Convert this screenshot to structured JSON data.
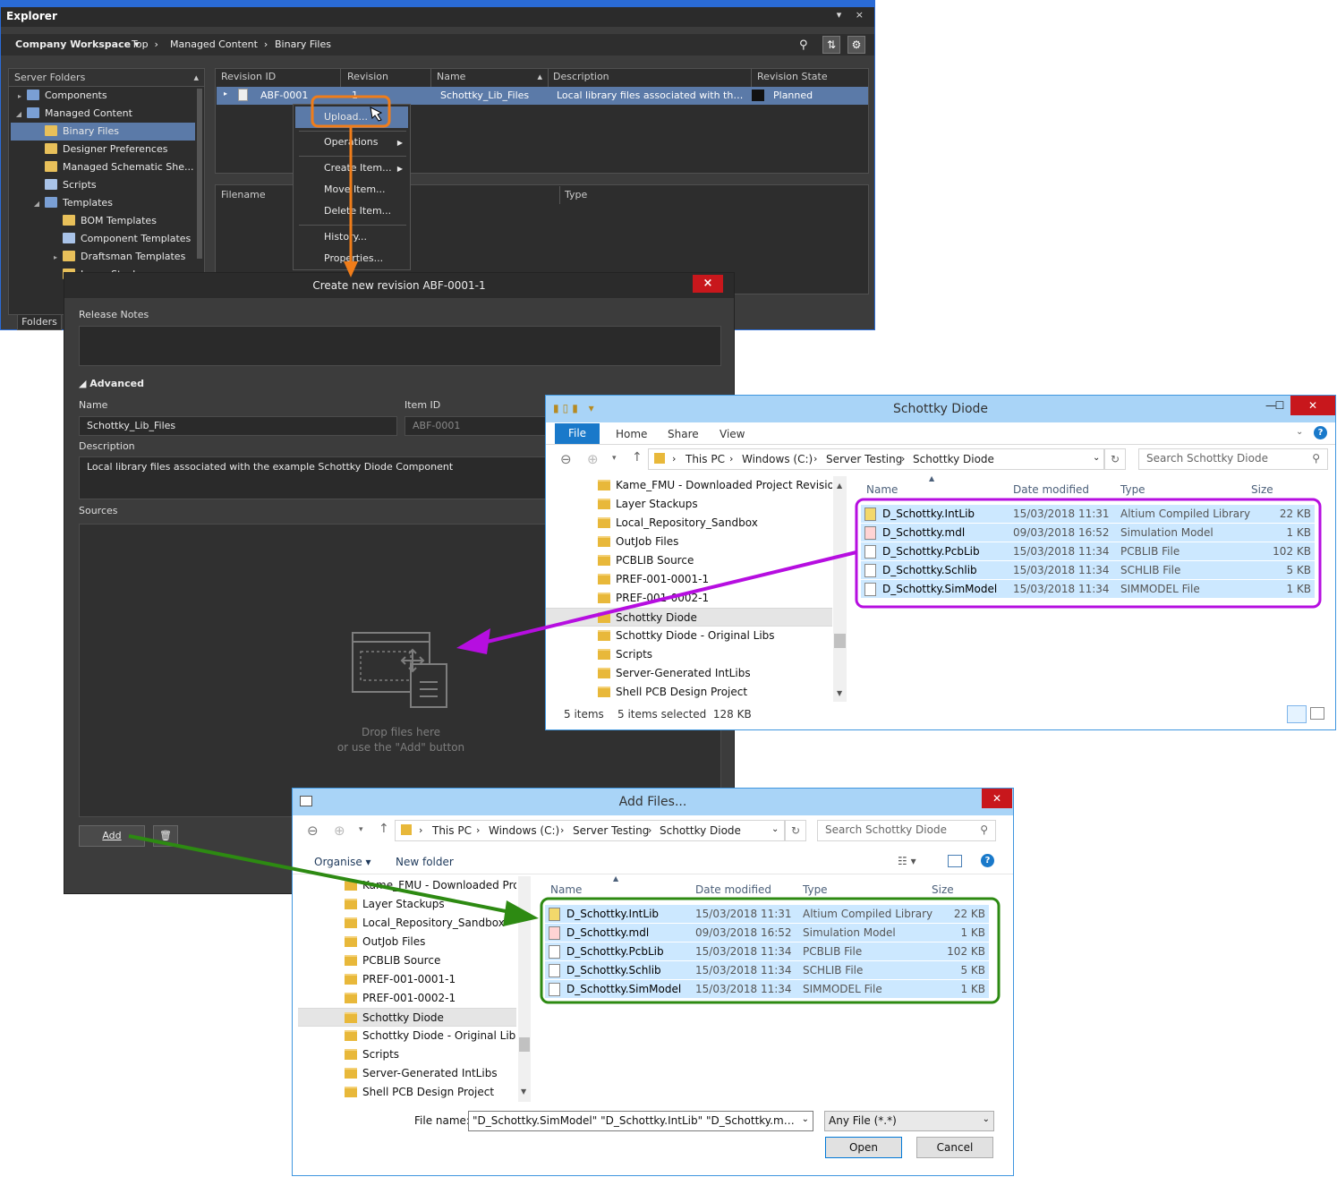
{
  "explorer": {
    "title": "Explorer",
    "controls": "▾ ×",
    "workspace": "Company Workspace",
    "breadcrumbs": [
      "Top",
      "Managed Content",
      "Binary Files"
    ],
    "folders_header": "Server Folders",
    "folders": [
      {
        "label": "Components",
        "indent": 0,
        "arrow": "▸",
        "color": "#7a9fd4"
      },
      {
        "label": "Managed Content",
        "indent": 0,
        "arrow": "◢",
        "color": "#7a9fd4"
      },
      {
        "label": "Binary Files",
        "indent": 1,
        "arrow": "",
        "color": "#e8c05a",
        "selected": true
      },
      {
        "label": "Designer Preferences",
        "indent": 1,
        "arrow": "",
        "color": "#e8c05a"
      },
      {
        "label": "Managed Schematic She...",
        "indent": 1,
        "arrow": "",
        "color": "#e8c05a"
      },
      {
        "label": "Scripts",
        "indent": 1,
        "arrow": "",
        "color": "#a9c3e8"
      },
      {
        "label": "Templates",
        "indent": 1,
        "arrow": "◢",
        "color": "#7a9fd4"
      },
      {
        "label": "BOM Templates",
        "indent": 2,
        "arrow": "",
        "color": "#e8c05a"
      },
      {
        "label": "Component Templates",
        "indent": 2,
        "arrow": "",
        "color": "#a9c3e8"
      },
      {
        "label": "Draftsman Templates",
        "indent": 2,
        "arrow": "▸",
        "color": "#e8c05a"
      },
      {
        "label": "Layer Stacks",
        "indent": 2,
        "arrow": "",
        "color": "#e8c05a"
      }
    ],
    "folders_tab": "Folders",
    "grid_headers": [
      "Revision ID",
      "Revision",
      "Name",
      "Description",
      "Revision State"
    ],
    "row": {
      "revision_id": "ABF-0001",
      "revision": "1",
      "name": "Schottky_Lib_Files",
      "description": "Local library files associated with the exam...",
      "state": "Planned"
    },
    "files_headers": [
      "Filename",
      "Type"
    ],
    "context_menu": [
      "Upload...",
      "Operations",
      "Create Item...",
      "Move Item...",
      "Delete Item...",
      "History...",
      "Properties..."
    ]
  },
  "dialog": {
    "title": "Create new revision ABF-0001-1",
    "close": "×",
    "release_notes_label": "Release Notes",
    "advanced_label": "Advanced",
    "name_label": "Name",
    "name_value": "Schottky_Lib_Files",
    "item_id_label": "Item ID",
    "item_id_value": "ABF-0001",
    "description_label": "Description",
    "description_value": "Local library files associated with the example Schottky Diode Component",
    "sources_label": "Sources",
    "drop_line1": "Drop files here",
    "drop_line2": "or use the \"Add\" button",
    "add_button": "Add",
    "delete_icon": "🗑"
  },
  "win1": {
    "title": "Schottky Diode",
    "ribbon_tabs": [
      "File",
      "Home",
      "Share",
      "View"
    ],
    "path": [
      "This PC",
      "Windows (C:)",
      "Server Testing",
      "Schottky Diode"
    ],
    "search_placeholder": "Search Schottky Diode",
    "status_items": "5 items",
    "status_selected": "5 items selected  128 KB"
  },
  "win2": {
    "title": "Add Files...",
    "path": [
      "This PC",
      "Windows (C:)",
      "Server Testing",
      "Schottky Diode"
    ],
    "search_placeholder": "Search Schottky Diode",
    "organise": "Organise ▾",
    "new_folder": "New folder",
    "file_name_label": "File name:",
    "file_name_value": "\"D_Schottky.SimModel\" \"D_Schottky.IntLib\" \"D_Schottky.mdl\" \"D_Scl",
    "filter": "Any File (*.*)",
    "open": "Open",
    "cancel": "Cancel"
  },
  "nav_folders": [
    "Kame_FMU - Downloaded Project Revisions",
    "Layer Stackups",
    "Local_Repository_Sandbox",
    "OutJob Files",
    "PCBLIB Source",
    "PREF-001-0001-1",
    "PREF-001-0002-1",
    "Schottky Diode",
    "Schottky Diode - Original Libs",
    "Scripts",
    "Server-Generated IntLibs",
    "Shell PCB Design Project"
  ],
  "nav_folders2_first": "Kame_FMU - Downloaded Projec",
  "file_columns": [
    "Name",
    "Date modified",
    "Type",
    "Size"
  ],
  "files": [
    {
      "name": "D_Schottky.IntLib",
      "date": "15/03/2018 11:31",
      "type": "Altium Compiled Library",
      "size": "22 KB"
    },
    {
      "name": "D_Schottky.mdl",
      "date": "09/03/2018 16:52",
      "type": "Simulation Model",
      "size": "1 KB"
    },
    {
      "name": "D_Schottky.PcbLib",
      "date": "15/03/2018 11:34",
      "type": "PCBLIB File",
      "size": "102 KB"
    },
    {
      "name": "D_Schottky.Schlib",
      "date": "15/03/2018 11:34",
      "type": "SCHLIB File",
      "size": "5 KB"
    },
    {
      "name": "D_Schottky.SimModel",
      "date": "15/03/2018 11:34",
      "type": "SIMMODEL File",
      "size": "1 KB"
    }
  ],
  "colors": {
    "upload_highlight": "#f07d1a",
    "purple_arrow": "#b60ee0",
    "green_arrow": "#2d8a12",
    "selection": "#cce8ff"
  }
}
